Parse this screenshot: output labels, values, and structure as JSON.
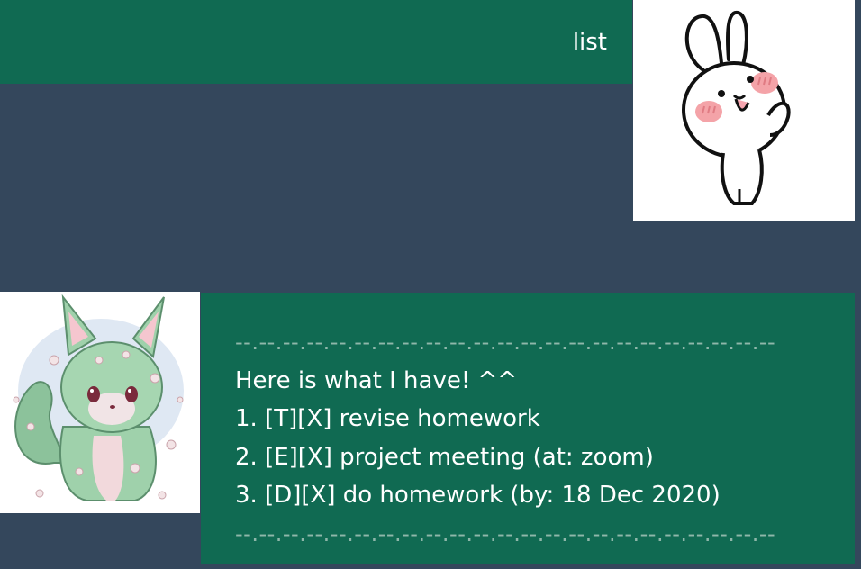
{
  "conversation": {
    "user_message": "list",
    "bot_reply": {
      "divider_top": "--.--.--.--.--.--.--.--.--.--.--.--.--.--.--.--.--.--.--.--.--.--.--",
      "intro": "Here is what I have! ^^",
      "tasks": [
        "1. [T][X] revise homework",
        "2. [E][X] project meeting (at: zoom)",
        "3. [D][X] do homework (by: 18 Dec 2020)"
      ],
      "divider_bottom": "--.--.--.--.--.--.--.--.--.--.--.--.--.--.--.--.--.--.--.--.--.--.--"
    }
  },
  "avatars": {
    "user": "rabbit-avatar-icon",
    "bot": "fox-avatar-icon"
  },
  "colors": {
    "background": "#34475c",
    "bubble": "#106a52",
    "text": "#ffffff"
  }
}
